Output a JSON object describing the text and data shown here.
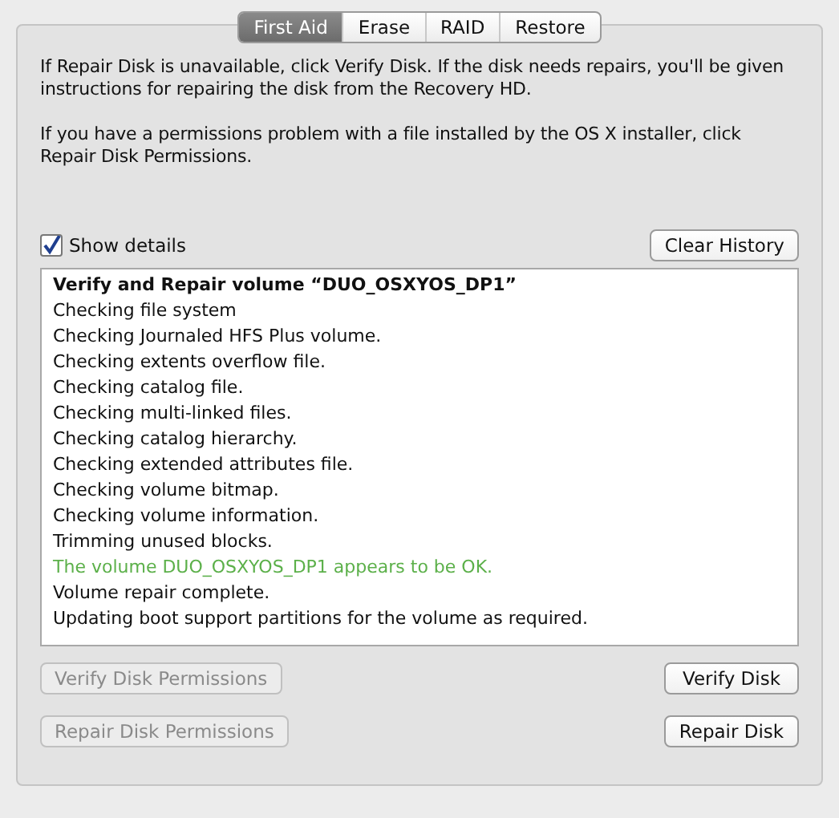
{
  "tabs": [
    {
      "label": "First Aid",
      "selected": true
    },
    {
      "label": "Erase",
      "selected": false
    },
    {
      "label": "RAID",
      "selected": false
    },
    {
      "label": "Restore",
      "selected": false
    }
  ],
  "paragraphs": [
    "If Repair Disk is unavailable, click Verify Disk. If the disk needs repairs, you'll be given instructions for repairing the disk from the Recovery HD.",
    "If you have a permissions problem with a file installed by the OS X installer, click Repair Disk Permissions."
  ],
  "show_details": {
    "label": "Show details",
    "checked": true
  },
  "clear_history": {
    "label": "Clear History",
    "disabled": false
  },
  "log": [
    {
      "kind": "heading",
      "text": "Verify and Repair volume “DUO_OSXYOS_DP1”"
    },
    {
      "kind": "normal",
      "text": "Checking file system"
    },
    {
      "kind": "normal",
      "text": "Checking Journaled HFS Plus volume."
    },
    {
      "kind": "normal",
      "text": "Checking extents overflow file."
    },
    {
      "kind": "normal",
      "text": "Checking catalog file."
    },
    {
      "kind": "normal",
      "text": "Checking multi-linked files."
    },
    {
      "kind": "normal",
      "text": "Checking catalog hierarchy."
    },
    {
      "kind": "normal",
      "text": "Checking extended attributes file."
    },
    {
      "kind": "normal",
      "text": "Checking volume bitmap."
    },
    {
      "kind": "normal",
      "text": "Checking volume information."
    },
    {
      "kind": "normal",
      "text": "Trimming unused blocks."
    },
    {
      "kind": "success",
      "text": "The volume DUO_OSXYOS_DP1 appears to be OK."
    },
    {
      "kind": "normal",
      "text": "Volume repair complete."
    },
    {
      "kind": "normal",
      "text": "Updating boot support partitions for the volume as required."
    }
  ],
  "button_rows": [
    [
      {
        "label": "Verify Disk Permissions",
        "disabled": true
      },
      {
        "label": "Verify Disk",
        "disabled": false
      }
    ],
    [
      {
        "label": "Repair Disk Permissions",
        "disabled": true
      },
      {
        "label": "Repair Disk",
        "disabled": false
      }
    ]
  ]
}
